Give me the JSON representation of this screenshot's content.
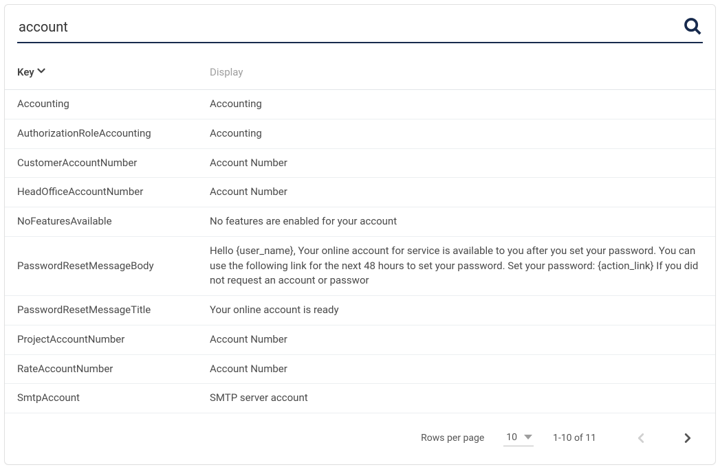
{
  "search": {
    "value": "account",
    "placeholder": ""
  },
  "columns": {
    "key": "Key",
    "display": "Display"
  },
  "rows": [
    {
      "key": "Accounting",
      "display": "Accounting"
    },
    {
      "key": "AuthorizationRoleAccounting",
      "display": "Accounting"
    },
    {
      "key": "CustomerAccountNumber",
      "display": "Account Number"
    },
    {
      "key": "HeadOfficeAccountNumber",
      "display": "Account Number"
    },
    {
      "key": "NoFeaturesAvailable",
      "display": "No features are enabled for your account"
    },
    {
      "key": "PasswordResetMessageBody",
      "display": "Hello {user_name}, Your online account for service is available to you after you set your password. You can use the following link for the next 48 hours to set your password. Set your password: {action_link} If you did not request an account or passwor"
    },
    {
      "key": "PasswordResetMessageTitle",
      "display": "Your online account is ready"
    },
    {
      "key": "ProjectAccountNumber",
      "display": "Account Number"
    },
    {
      "key": "RateAccountNumber",
      "display": "Account Number"
    },
    {
      "key": "SmtpAccount",
      "display": "SMTP server account"
    }
  ],
  "pagination": {
    "rows_per_page_label": "Rows per page",
    "rows_per_page_value": "10",
    "range_text": "1-10 of 11"
  }
}
